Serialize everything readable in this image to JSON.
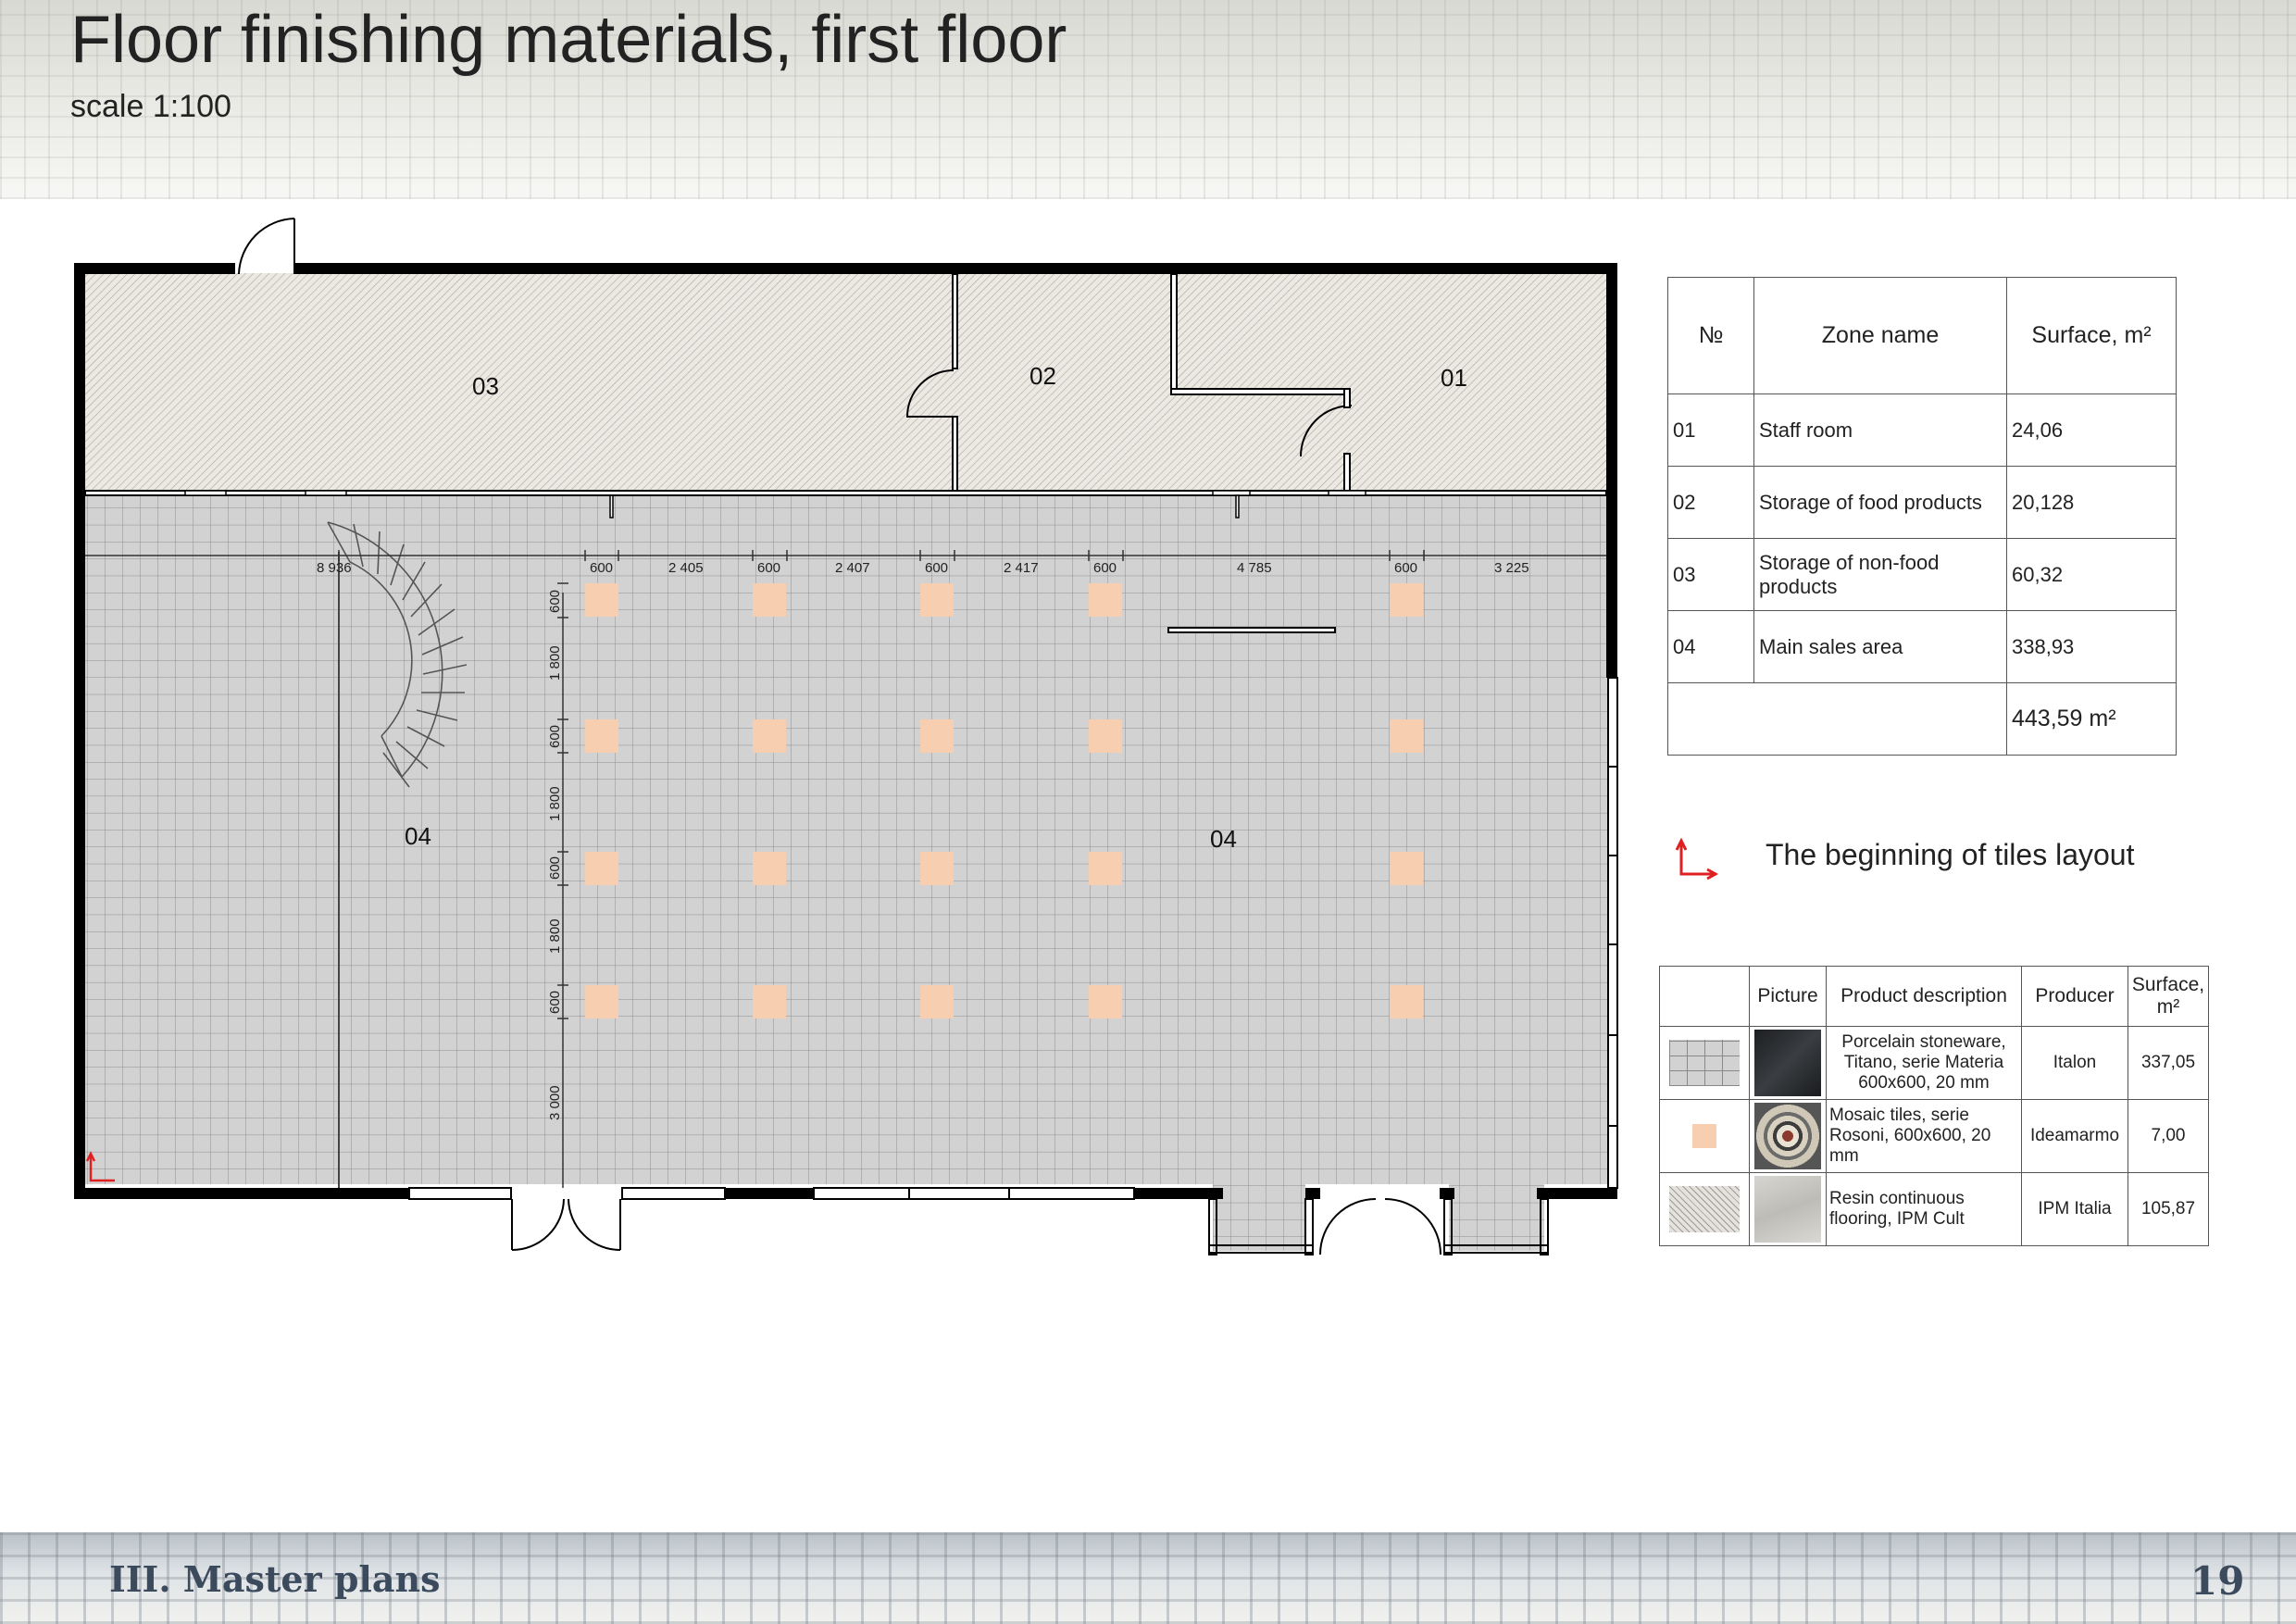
{
  "header": {
    "title": "Floor finishing materials, first floor",
    "subtitle": "scale 1:100"
  },
  "plan": {
    "zone_labels": [
      "03",
      "02",
      "01",
      "04",
      "04"
    ],
    "dimensions_top": [
      "8 936",
      "600",
      "2 405",
      "600",
      "2 407",
      "600",
      "2 417",
      "600",
      "4 785",
      "600",
      "3 225"
    ],
    "dimensions_left": [
      "600",
      "1 800",
      "600",
      "1 800",
      "600",
      "1 800",
      "600",
      "3 000"
    ],
    "colors": {
      "wall": "#000000",
      "porcelain_tile": "#d2d2d2",
      "mosaic_tile": "#f7cfb0",
      "resin": "#ece9e3",
      "tile_start_marker": "#e02020"
    }
  },
  "zones_table": {
    "headers": [
      "№",
      "Zone name",
      "Surface, m²"
    ],
    "rows": [
      {
        "no": "01",
        "name": "Staff room",
        "surface": "24,06"
      },
      {
        "no": "02",
        "name": "Storage of food products",
        "surface": "20,128"
      },
      {
        "no": "03",
        "name": "Storage of non-food products",
        "surface": "60,32"
      },
      {
        "no": "04",
        "name": "Main sales area",
        "surface": "338,93"
      }
    ],
    "total": "443,59 m²"
  },
  "legend": {
    "marker_icon": "corner-arrow-icon",
    "text": "The beginning of tiles layout"
  },
  "materials_table": {
    "headers": [
      "",
      "Picture",
      "Product description",
      "Producer",
      "Surface, m²"
    ],
    "rows": [
      {
        "description": "Porcelain stoneware, Titano, serie Materia 600x600, 20 mm",
        "producer": "Italon",
        "surface": "337,05"
      },
      {
        "description": "Mosaic tiles, serie Rosoni, 600x600, 20 mm",
        "producer": "Ideamarmo",
        "surface": "7,00"
      },
      {
        "description": "Resin continuous flooring, IPM Cult",
        "producer": "IPM Italia",
        "surface": "105,87"
      }
    ]
  },
  "footer": {
    "section": "III. Master plans",
    "page_number": "19"
  }
}
